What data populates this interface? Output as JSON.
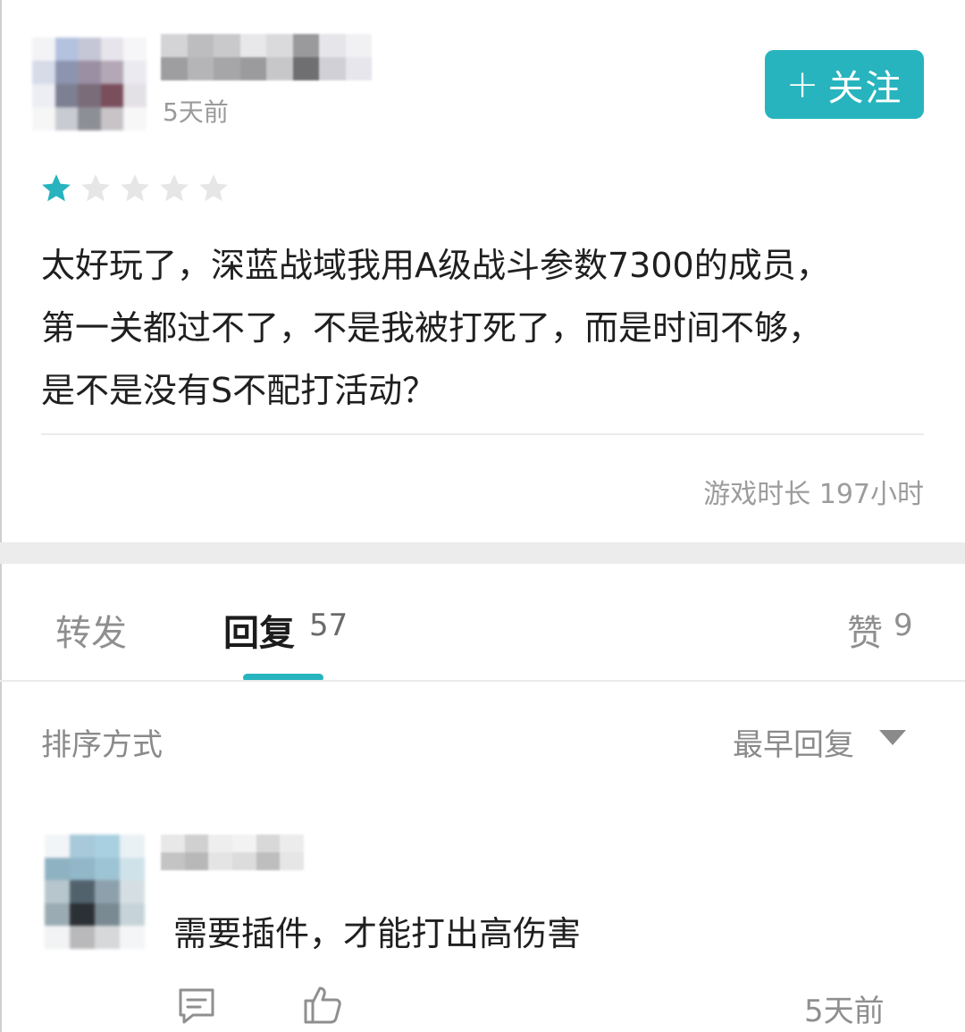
{
  "post": {
    "time_ago": "5天前",
    "follow_label": "关注",
    "rating": 1,
    "max_rating": 5,
    "star_active_color": "#27b4be",
    "star_inactive_color": "#e6e6e6",
    "review_lines": [
      "太好玩了，深蓝战域我用A级战斗参数7300的成员，",
      "第一关都过不了，不是我被打死了，而是时间不够，",
      "是不是没有S不配打活动？"
    ],
    "playtime": "游戏时长 197小时"
  },
  "tabs": {
    "forward_label": "转发",
    "reply_label": "回复",
    "reply_count": "57",
    "like_label": "赞",
    "like_count": "9"
  },
  "sort": {
    "label": "排序方式",
    "value": "最早回复"
  },
  "reply": {
    "text": "需要插件，才能打出高伤害",
    "time_ago": "5天前",
    "comment_icon": "comment-icon",
    "like_icon": "thumbs-up-icon"
  },
  "accent_color": "#27b4be"
}
